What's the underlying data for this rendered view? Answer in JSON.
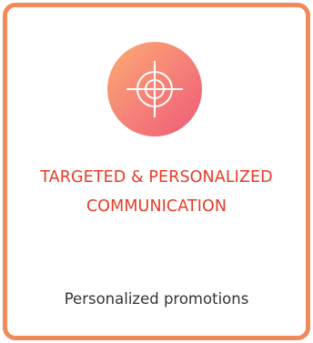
{
  "card": {
    "icon": "crosshair-target-icon",
    "title_line1": "TARGETED & PERSONALIZED",
    "title_line2": "COMMUNICATION",
    "subtitle": "Personalized promotions"
  },
  "colors": {
    "border": "#ef8a5a",
    "title": "#e63b26",
    "icon_gradient_start": "#fbab73",
    "icon_gradient_end": "#ee5a78",
    "subtitle": "#333333"
  }
}
